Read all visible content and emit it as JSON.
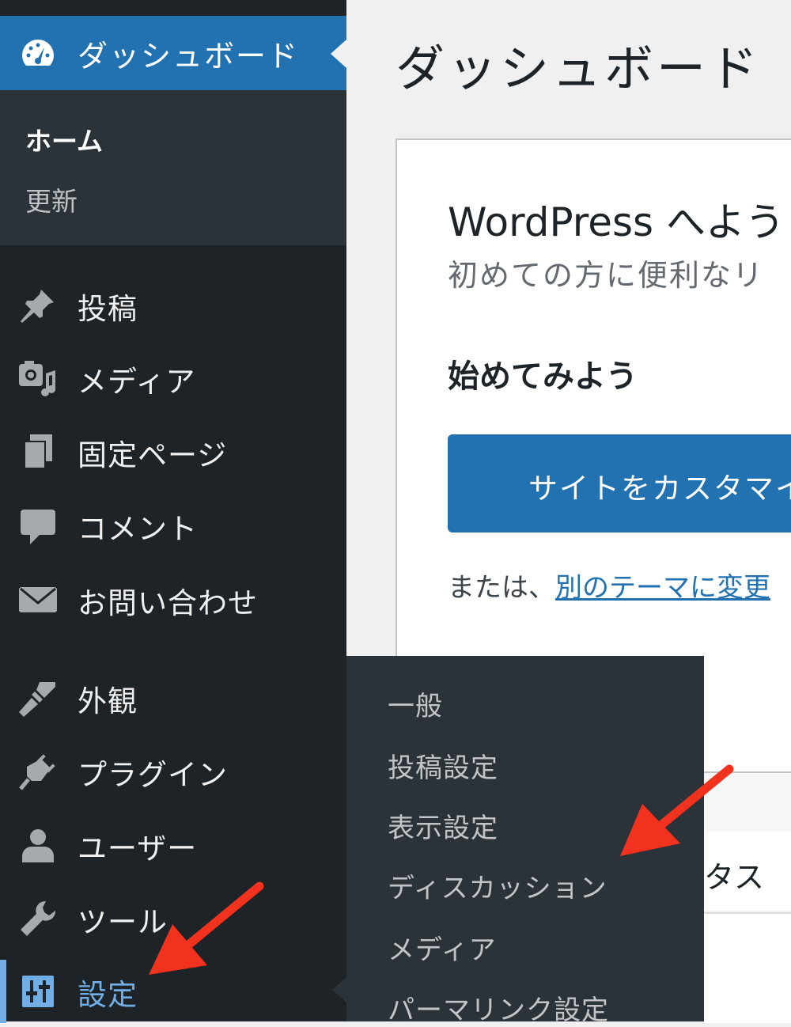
{
  "sidebar": {
    "dashboard_label": "ダッシュボード",
    "submenu": {
      "home": "ホーム",
      "update": "更新"
    },
    "items": [
      {
        "label": "投稿",
        "icon": "pin-icon"
      },
      {
        "label": "メディア",
        "icon": "media-icon"
      },
      {
        "label": "固定ページ",
        "icon": "pages-icon"
      },
      {
        "label": "コメント",
        "icon": "comment-icon"
      },
      {
        "label": "お問い合わせ",
        "icon": "mail-icon"
      },
      {
        "label": "外観",
        "icon": "brush-icon"
      },
      {
        "label": "プラグイン",
        "icon": "plugin-icon"
      },
      {
        "label": "ユーザー",
        "icon": "user-icon"
      },
      {
        "label": "ツール",
        "icon": "wrench-icon"
      },
      {
        "label": "設定",
        "icon": "settings-icon"
      }
    ]
  },
  "main": {
    "page_title": "ダッシュボード",
    "welcome": {
      "title": "WordPress へよう",
      "subtitle": "初めての方に便利なリ",
      "start_heading": "始めてみよう",
      "customize_button": "サイトをカスタマイ",
      "or_text": "または、",
      "theme_link": "別のテーマに変更"
    },
    "lower_partial_text": "タス"
  },
  "flyout": {
    "items": [
      "一般",
      "投稿設定",
      "表示設定",
      "ディスカッション",
      "メディア",
      "パーマリンク設定"
    ]
  },
  "colors": {
    "sidebar_bg": "#1d2327",
    "submenu_bg": "#2c3338",
    "accent": "#2271b1",
    "active_text": "#72aee6",
    "annotation_arrow": "#f0321e"
  }
}
